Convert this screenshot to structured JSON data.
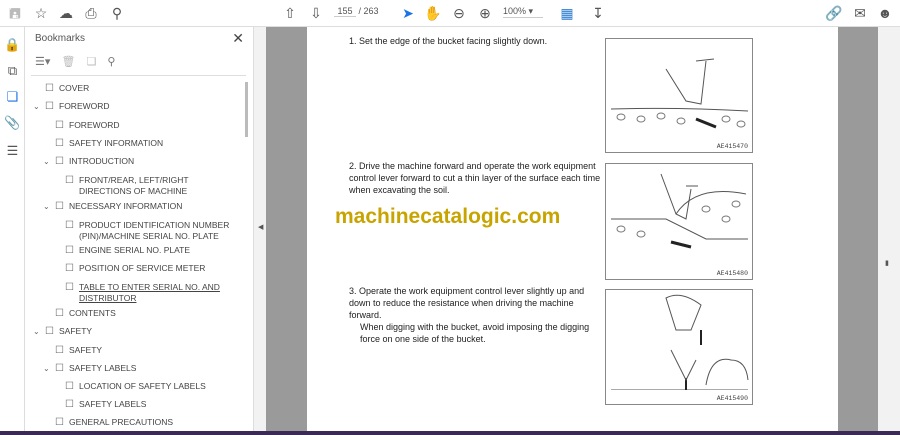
{
  "toolbar": {
    "current_page": "155",
    "total_pages": "/ 263",
    "zoom": "100%"
  },
  "bookmarks": {
    "title": "Bookmarks",
    "items": [
      {
        "label": "COVER"
      },
      {
        "label": "FOREWORD"
      },
      {
        "label": "FOREWORD"
      },
      {
        "label": "SAFETY INFORMATION"
      },
      {
        "label": "INTRODUCTION"
      },
      {
        "label": "FRONT/REAR, LEFT/RIGHT DIRECTIONS OF MACHINE"
      },
      {
        "label": "NECESSARY INFORMATION"
      },
      {
        "label": "PRODUCT IDENTIFICATION NUMBER (PIN)/MACHINE SERIAL NO. PLATE"
      },
      {
        "label": "ENGINE SERIAL NO. PLATE"
      },
      {
        "label": "POSITION OF SERVICE METER"
      },
      {
        "label": "TABLE TO ENTER SERIAL NO. AND DISTRIBUTOR"
      },
      {
        "label": "CONTENTS"
      },
      {
        "label": "SAFETY"
      },
      {
        "label": "SAFETY"
      },
      {
        "label": "SAFETY LABELS"
      },
      {
        "label": "LOCATION OF SAFETY LABELS"
      },
      {
        "label": "SAFETY LABELS"
      },
      {
        "label": "GENERAL PRECAUTIONS"
      }
    ]
  },
  "document": {
    "step1": "1. Set the edge of the bucket facing slightly down.",
    "step2": "2. Drive the machine forward and operate the work equipment control lever forward to cut a thin layer of the surface each time when excavating the soil.",
    "step3": "3. Operate the work equipment control lever slightly up and down to reduce the resistance when driving the machine forward.",
    "step3_note": "When digging with the bucket, avoid imposing the digging force on one side of the bucket.",
    "fig1": "AE415470",
    "fig2": "AE415480",
    "fig3": "AE415490",
    "watermark": "machinecatalogic.com"
  }
}
